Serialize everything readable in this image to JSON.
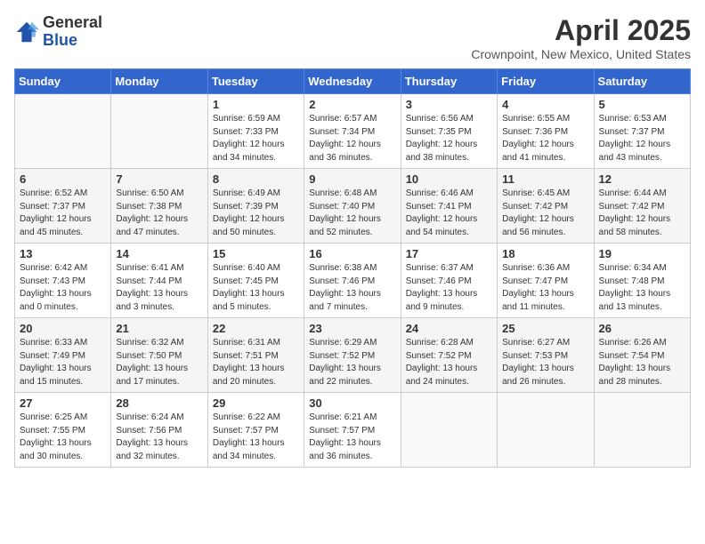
{
  "logo": {
    "general": "General",
    "blue": "Blue"
  },
  "title": "April 2025",
  "location": "Crownpoint, New Mexico, United States",
  "days_of_week": [
    "Sunday",
    "Monday",
    "Tuesday",
    "Wednesday",
    "Thursday",
    "Friday",
    "Saturday"
  ],
  "weeks": [
    [
      {
        "day": "",
        "info": ""
      },
      {
        "day": "",
        "info": ""
      },
      {
        "day": "1",
        "info": "Sunrise: 6:59 AM\nSunset: 7:33 PM\nDaylight: 12 hours and 34 minutes."
      },
      {
        "day": "2",
        "info": "Sunrise: 6:57 AM\nSunset: 7:34 PM\nDaylight: 12 hours and 36 minutes."
      },
      {
        "day": "3",
        "info": "Sunrise: 6:56 AM\nSunset: 7:35 PM\nDaylight: 12 hours and 38 minutes."
      },
      {
        "day": "4",
        "info": "Sunrise: 6:55 AM\nSunset: 7:36 PM\nDaylight: 12 hours and 41 minutes."
      },
      {
        "day": "5",
        "info": "Sunrise: 6:53 AM\nSunset: 7:37 PM\nDaylight: 12 hours and 43 minutes."
      }
    ],
    [
      {
        "day": "6",
        "info": "Sunrise: 6:52 AM\nSunset: 7:37 PM\nDaylight: 12 hours and 45 minutes."
      },
      {
        "day": "7",
        "info": "Sunrise: 6:50 AM\nSunset: 7:38 PM\nDaylight: 12 hours and 47 minutes."
      },
      {
        "day": "8",
        "info": "Sunrise: 6:49 AM\nSunset: 7:39 PM\nDaylight: 12 hours and 50 minutes."
      },
      {
        "day": "9",
        "info": "Sunrise: 6:48 AM\nSunset: 7:40 PM\nDaylight: 12 hours and 52 minutes."
      },
      {
        "day": "10",
        "info": "Sunrise: 6:46 AM\nSunset: 7:41 PM\nDaylight: 12 hours and 54 minutes."
      },
      {
        "day": "11",
        "info": "Sunrise: 6:45 AM\nSunset: 7:42 PM\nDaylight: 12 hours and 56 minutes."
      },
      {
        "day": "12",
        "info": "Sunrise: 6:44 AM\nSunset: 7:42 PM\nDaylight: 12 hours and 58 minutes."
      }
    ],
    [
      {
        "day": "13",
        "info": "Sunrise: 6:42 AM\nSunset: 7:43 PM\nDaylight: 13 hours and 0 minutes."
      },
      {
        "day": "14",
        "info": "Sunrise: 6:41 AM\nSunset: 7:44 PM\nDaylight: 13 hours and 3 minutes."
      },
      {
        "day": "15",
        "info": "Sunrise: 6:40 AM\nSunset: 7:45 PM\nDaylight: 13 hours and 5 minutes."
      },
      {
        "day": "16",
        "info": "Sunrise: 6:38 AM\nSunset: 7:46 PM\nDaylight: 13 hours and 7 minutes."
      },
      {
        "day": "17",
        "info": "Sunrise: 6:37 AM\nSunset: 7:46 PM\nDaylight: 13 hours and 9 minutes."
      },
      {
        "day": "18",
        "info": "Sunrise: 6:36 AM\nSunset: 7:47 PM\nDaylight: 13 hours and 11 minutes."
      },
      {
        "day": "19",
        "info": "Sunrise: 6:34 AM\nSunset: 7:48 PM\nDaylight: 13 hours and 13 minutes."
      }
    ],
    [
      {
        "day": "20",
        "info": "Sunrise: 6:33 AM\nSunset: 7:49 PM\nDaylight: 13 hours and 15 minutes."
      },
      {
        "day": "21",
        "info": "Sunrise: 6:32 AM\nSunset: 7:50 PM\nDaylight: 13 hours and 17 minutes."
      },
      {
        "day": "22",
        "info": "Sunrise: 6:31 AM\nSunset: 7:51 PM\nDaylight: 13 hours and 20 minutes."
      },
      {
        "day": "23",
        "info": "Sunrise: 6:29 AM\nSunset: 7:52 PM\nDaylight: 13 hours and 22 minutes."
      },
      {
        "day": "24",
        "info": "Sunrise: 6:28 AM\nSunset: 7:52 PM\nDaylight: 13 hours and 24 minutes."
      },
      {
        "day": "25",
        "info": "Sunrise: 6:27 AM\nSunset: 7:53 PM\nDaylight: 13 hours and 26 minutes."
      },
      {
        "day": "26",
        "info": "Sunrise: 6:26 AM\nSunset: 7:54 PM\nDaylight: 13 hours and 28 minutes."
      }
    ],
    [
      {
        "day": "27",
        "info": "Sunrise: 6:25 AM\nSunset: 7:55 PM\nDaylight: 13 hours and 30 minutes."
      },
      {
        "day": "28",
        "info": "Sunrise: 6:24 AM\nSunset: 7:56 PM\nDaylight: 13 hours and 32 minutes."
      },
      {
        "day": "29",
        "info": "Sunrise: 6:22 AM\nSunset: 7:57 PM\nDaylight: 13 hours and 34 minutes."
      },
      {
        "day": "30",
        "info": "Sunrise: 6:21 AM\nSunset: 7:57 PM\nDaylight: 13 hours and 36 minutes."
      },
      {
        "day": "",
        "info": ""
      },
      {
        "day": "",
        "info": ""
      },
      {
        "day": "",
        "info": ""
      }
    ]
  ]
}
